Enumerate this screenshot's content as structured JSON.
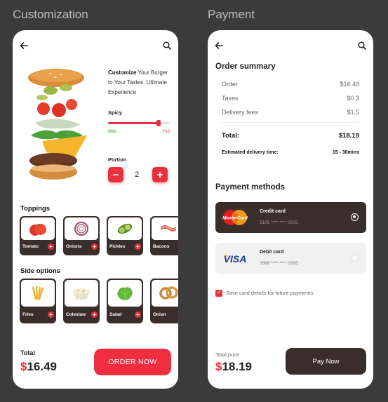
{
  "sections": {
    "left_title": "Customization",
    "right_title": "Payment"
  },
  "customize": {
    "heading_bold": "Customize",
    "heading_rest": " Your Burger to Your Tastes. Ultimate Experience",
    "spicy_label": "Spicy",
    "spicy_min_label": "Mild",
    "spicy_max_label": "Hot",
    "spicy_level": 0.82,
    "portion_label": "Portion",
    "portion_minus": "−",
    "portion_plus": "+",
    "portion_value": "2"
  },
  "toppings": {
    "title": "Toppings",
    "items": [
      {
        "name": "Tomato",
        "icon": "tomato-icon"
      },
      {
        "name": "Onions",
        "icon": "onion-icon"
      },
      {
        "name": "Pickles",
        "icon": "pickle-icon"
      },
      {
        "name": "Bacons",
        "icon": "bacon-icon"
      }
    ]
  },
  "side_options": {
    "title": "Side options",
    "items": [
      {
        "name": "Fries",
        "icon": "fries-icon"
      },
      {
        "name": "Coleslaw",
        "icon": "coleslaw-icon"
      },
      {
        "name": "Salad",
        "icon": "salad-icon"
      },
      {
        "name": "Onion",
        "icon": "onion-rings-icon"
      }
    ]
  },
  "left_footer": {
    "total_label": "Total",
    "currency": "$",
    "total_value": "16.49",
    "order_button": "ORDER NOW"
  },
  "order_summary": {
    "title": "Order summary",
    "rows": [
      {
        "label": "Order",
        "value": "$16.48"
      },
      {
        "label": "Taxes",
        "value": "$0.3"
      },
      {
        "label": "Delivery fees",
        "value": "$1.5"
      }
    ],
    "total_label": "Total:",
    "total_value": "$18.19",
    "eta_label": "Estimated delivery time:",
    "eta_value": "15 - 30mins"
  },
  "payment_methods": {
    "title": "Payment methods",
    "cards": [
      {
        "brand": "MasterCard",
        "name": "Credit card",
        "number": "5105 **** **** 0505",
        "selected": true
      },
      {
        "brand": "VISA",
        "name": "Debit card",
        "number": "3566 **** **** 0505",
        "selected": false
      }
    ],
    "save_label": "Save card details for future payments"
  },
  "right_footer": {
    "total_label": "Total price",
    "currency": "$",
    "total_value": "18.19",
    "pay_button": "Pay Now"
  },
  "colors": {
    "accent": "#e8313f",
    "dark": "#3a2e2b",
    "background": "#3c3b3b"
  }
}
